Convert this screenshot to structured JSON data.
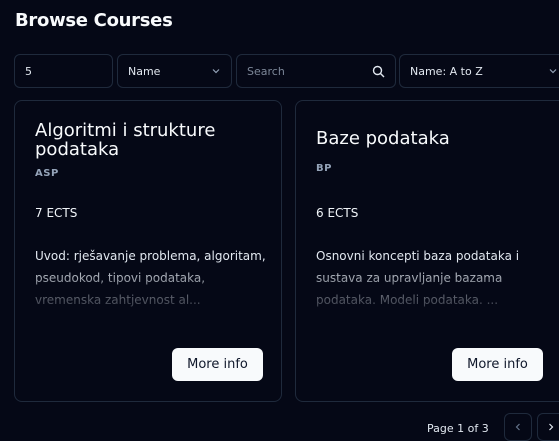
{
  "page": {
    "title": "Browse Courses"
  },
  "filters": {
    "value_input": "5",
    "field_select": "Name",
    "search_placeholder": "Search",
    "sort_select": "Name: A to Z"
  },
  "courses": [
    {
      "title": "Algoritmi i strukture podataka",
      "code": "ASP",
      "ects": "7 ECTS",
      "description": "Uvod: rješavanje problema, algoritam, pseudokod, tipovi podataka, vremenska zahtjevnost al...",
      "button": "More info"
    },
    {
      "title": "Baze podataka",
      "code": "BP",
      "ects": "6 ECTS",
      "description": "Osnovni koncepti baza podataka i sustava za upravljanje bazama podataka. Modeli podataka. ...",
      "button": "More info"
    }
  ],
  "pagination": {
    "label": "Page 1 of 3"
  },
  "icons": {
    "search": "search-icon",
    "chevron": "chevron-down-icon",
    "prev": "chevron-left-icon",
    "next": "chevron-right-icon"
  },
  "colors": {
    "background": "#050816",
    "border": "#1f2a3c",
    "button_bg": "#f8fafc",
    "button_text": "#0f172a"
  }
}
